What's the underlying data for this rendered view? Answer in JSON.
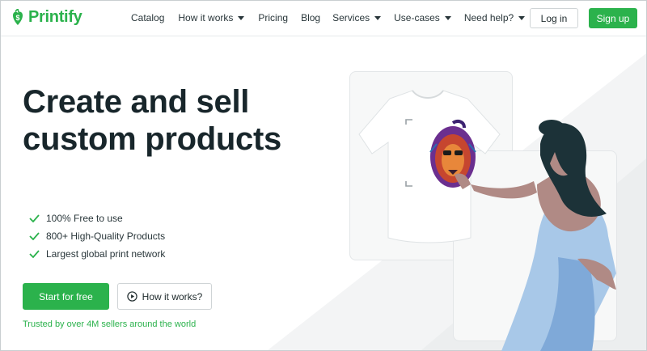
{
  "brand": {
    "name": "Printify",
    "color": "#2bb24c"
  },
  "nav": {
    "items": [
      {
        "label": "Catalog",
        "dropdown": false
      },
      {
        "label": "How it works",
        "dropdown": true
      },
      {
        "label": "Pricing",
        "dropdown": false
      },
      {
        "label": "Blog",
        "dropdown": false
      },
      {
        "label": "Services",
        "dropdown": true
      },
      {
        "label": "Use-cases",
        "dropdown": true
      },
      {
        "label": "Need help?",
        "dropdown": true
      }
    ],
    "login_label": "Log in",
    "signup_label": "Sign up"
  },
  "hero": {
    "headline": "Create and sell custom products",
    "features": [
      "100% Free to use",
      "800+ High-Quality Products",
      "Largest global print network"
    ],
    "cta_primary": "Start for free",
    "cta_secondary": "How it works?",
    "trusted": "Trusted by over 4M sellers around the world"
  },
  "icons": {
    "check": "check-icon",
    "play": "play-circle-icon",
    "caret": "chevron-down-icon",
    "logo": "printify-logo-icon"
  }
}
